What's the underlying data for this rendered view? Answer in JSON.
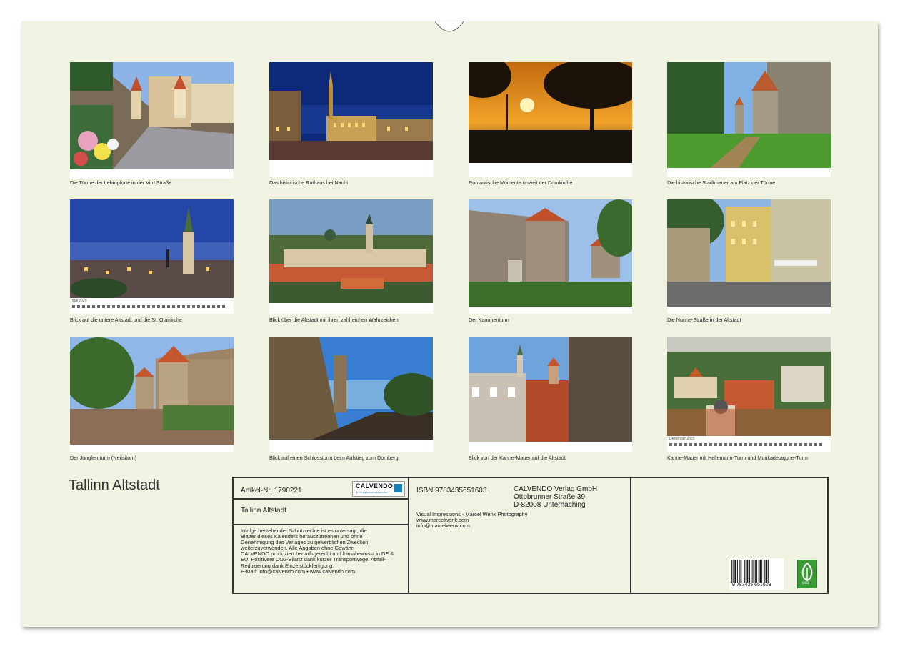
{
  "calendar": {
    "title": "Tallinn Altstadt",
    "photos": [
      {
        "caption": "Die Türme der Lehmpforte in der Viru Straße",
        "icon": "photo-street-market"
      },
      {
        "caption": "Das historische Rathaus bei Nacht",
        "icon": "photo-town-hall-night"
      },
      {
        "caption": "Romantische Momente unweit der Domkirche",
        "icon": "photo-sunset"
      },
      {
        "caption": "Die historische Stadtmauer am Platz der Türme",
        "icon": "photo-city-wall"
      },
      {
        "caption": "Blick auf die untere Altstadt und die St. Olaikirche",
        "icon": "photo-olai-church",
        "calendar_label": "Mai 2025"
      },
      {
        "caption": "Blick über die Altstadt mit ihren zahlreichen Wahrzeichen",
        "icon": "photo-panorama"
      },
      {
        "caption": "Der Kanonenturm",
        "icon": "photo-cannon-tower"
      },
      {
        "caption": "Die Nunne-Straße in der Altstadt",
        "icon": "photo-nunne-street"
      },
      {
        "caption": "Der Jungfernturm (Neitsitorn)",
        "icon": "photo-maiden-tower"
      },
      {
        "caption": "Blick auf einen Schlossturm beim Aufstieg zum Domberg",
        "icon": "photo-castle-tower"
      },
      {
        "caption": "Blick von der Kanne-Mauer auf die Altstadt",
        "icon": "photo-kanne-wall"
      },
      {
        "caption": "Kanne-Mauer mit Hellemann-Turm und Munkadetagune-Turm",
        "icon": "photo-rooftops",
        "calendar_label": "Dezember 2025"
      }
    ]
  },
  "info": {
    "article": "Artikel-Nr. 1790221",
    "logo_text": "CALVENDO",
    "logo_sub": "Kein Alpenreisekalender",
    "product_title": "Tallinn Altstadt",
    "legal": [
      "Infolge bestehender Schutzrechte ist es untersagt, die",
      "Blätter dieses Kalenders herauszutrennen und ohne",
      "Genehmigung des Verlages zu gewerblichen Zwecken",
      "weiterzuverwenden. Alle Angaben ohne Gewähr.",
      "CALVENDO produziert bedarfsgerecht und klimabewusst in DE &",
      "EU. Positivere CO2-Bilanz dank kurzer Transportwege. Abfall-",
      "Reduzierung dank Einzelstückfertigung.",
      "E-Mail: info@calvendo.com • www.calvendo.com"
    ],
    "isbn": "ISBN 9783435651603",
    "publisher": [
      "CALVENDO Verlag GmbH",
      "Ottobrunner Straße 39",
      "D-82008 Unterhaching"
    ],
    "author": [
      "Visual Impressions - Marcel Wenk Photography",
      "www.marcelwenk.com",
      "info@marcelwenk.com"
    ],
    "barcode_number": "9 783435 651603",
    "eco_label": "eco"
  }
}
